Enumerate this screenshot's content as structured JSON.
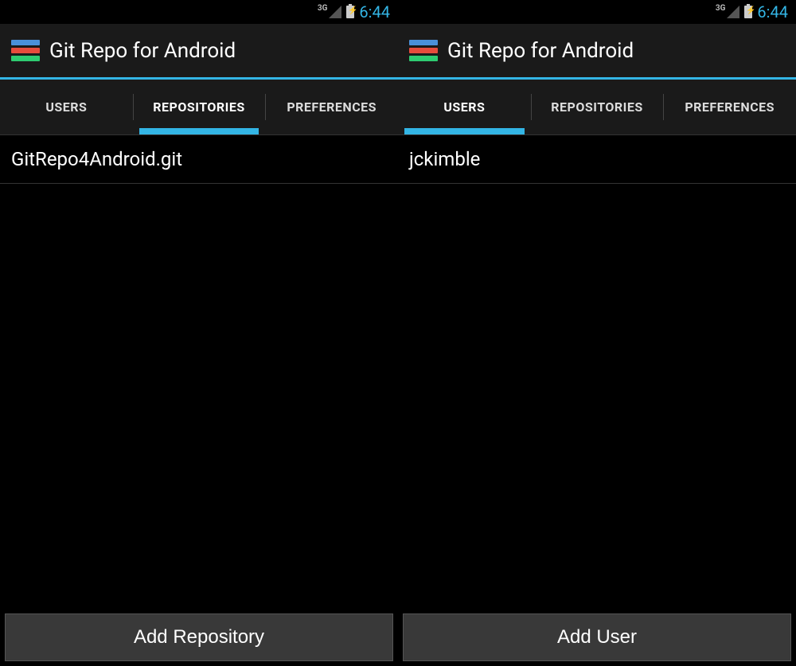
{
  "status": {
    "network": "3G",
    "time": "6:44"
  },
  "app": {
    "title": "Git Repo for Android"
  },
  "tabs": {
    "users": "USERS",
    "repositories": "REPOSITORIES",
    "preferences": "PREFERENCES"
  },
  "screen_left": {
    "active_tab": "repositories",
    "list_item": "GitRepo4Android.git",
    "button_label": "Add Repository"
  },
  "screen_right": {
    "active_tab": "users",
    "list_item": "jckimble",
    "button_label": "Add User"
  }
}
